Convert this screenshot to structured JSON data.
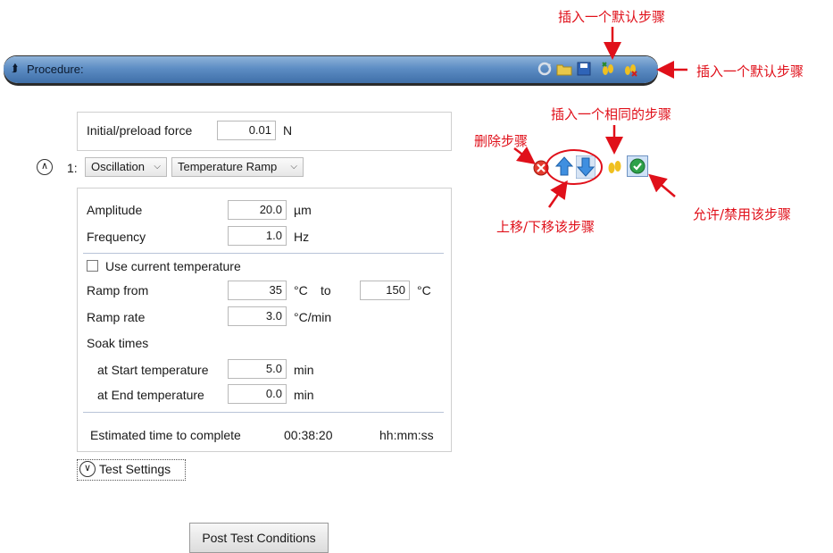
{
  "procedure": {
    "title": "Procedure:"
  },
  "preload": {
    "label": "Initial/preload force",
    "value": "0.01",
    "unit": "N"
  },
  "step": {
    "index": "1:",
    "type": "Oscillation",
    "mode": "Temperature Ramp",
    "amplitude": {
      "label": "Amplitude",
      "value": "20.0",
      "unit": "µm"
    },
    "frequency": {
      "label": "Frequency",
      "value": "1.0",
      "unit": "Hz"
    },
    "use_current_temp": "Use current temperature",
    "ramp_from": {
      "label": "Ramp from",
      "from": "35",
      "unit_from": "°C",
      "to_label": "to",
      "to": "150",
      "unit_to": "°C"
    },
    "ramp_rate": {
      "label": "Ramp rate",
      "value": "3.0",
      "unit": "°C/min"
    },
    "soak": {
      "label": "Soak times",
      "start": {
        "label": "at Start temperature",
        "value": "5.0",
        "unit": "min"
      },
      "end": {
        "label": "at End temperature",
        "value": "0.0",
        "unit": "min"
      }
    },
    "estimate": {
      "label": "Estimated time to complete",
      "value": "00:38:20",
      "format": "hh:mm:ss"
    }
  },
  "test_settings": "Test Settings",
  "post_test": "Post Test Conditions",
  "annotations": {
    "insert_default_top": "插入一个默认步骤",
    "insert_default_right": "插入一个默认步骤",
    "insert_same": "插入一个相同的步骤",
    "delete": "删除步骤",
    "move": "上移/下移该步骤",
    "enable": "允许/禁用该步骤"
  },
  "colors": {
    "bar": "#5d8dc4",
    "annotation": "#e0101a"
  }
}
